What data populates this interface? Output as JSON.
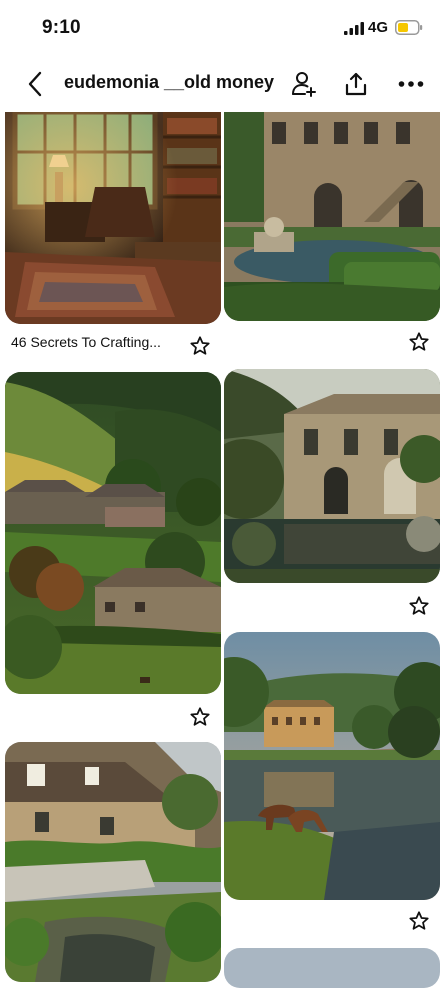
{
  "status": {
    "time": "9:10",
    "network": "4G"
  },
  "header": {
    "title": "eudemonia __old money"
  },
  "pins": [
    {
      "caption": "46 Secrets To Crafting..."
    }
  ]
}
